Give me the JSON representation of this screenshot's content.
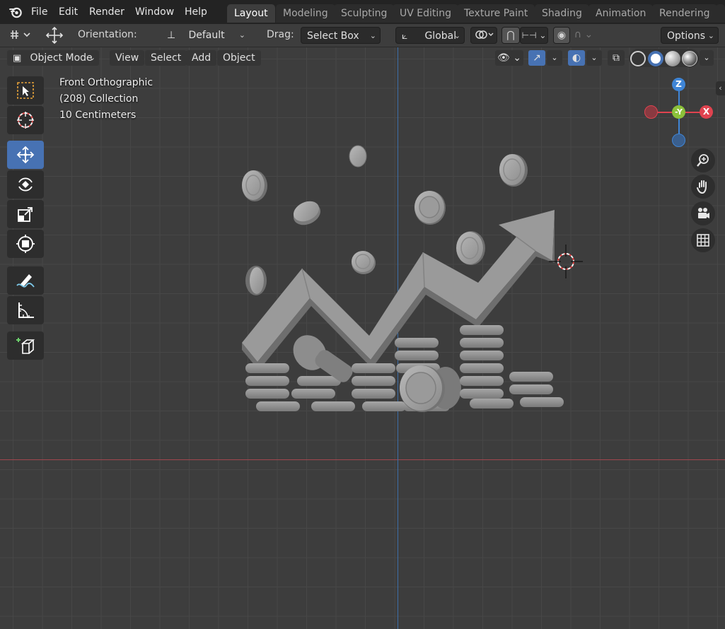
{
  "menu": {
    "items": [
      "File",
      "Edit",
      "Render",
      "Window",
      "Help"
    ]
  },
  "workspaces": {
    "tabs": [
      "Layout",
      "Modeling",
      "Sculpting",
      "UV Editing",
      "Texture Paint",
      "Shading",
      "Animation",
      "Rendering"
    ],
    "active": "Layout"
  },
  "tool_settings": {
    "orientation_label": "Orientation:",
    "orientation_value": "Default",
    "drag_label": "Drag:",
    "drag_value": "Select Box",
    "transform_orientation": "Global",
    "options_label": "Options"
  },
  "viewport_header": {
    "mode": "Object Mode",
    "menus": [
      "View",
      "Select",
      "Add",
      "Object"
    ]
  },
  "overlay_info": {
    "view_name": "Front Orthographic",
    "collection": "(208) Collection",
    "grid_scale": "10 Centimeters"
  },
  "gizmo": {
    "z_label": "Z",
    "y_label": "-Y",
    "x_label": "X"
  },
  "colors": {
    "accent": "#4772b3",
    "axis_x": "#e0434f",
    "axis_y": "#8cc13a",
    "axis_z": "#3f85d6",
    "viewport_bg": "#3d3d3d"
  },
  "icons": {
    "tools": [
      "select-box-icon",
      "cursor-icon",
      "move-icon",
      "rotate-icon",
      "scale-icon",
      "transform-icon",
      "annotate-icon",
      "measure-icon",
      "add-cube-icon"
    ],
    "nav": [
      "zoom-icon",
      "pan-hand-icon",
      "camera-icon",
      "grid-icon"
    ]
  }
}
